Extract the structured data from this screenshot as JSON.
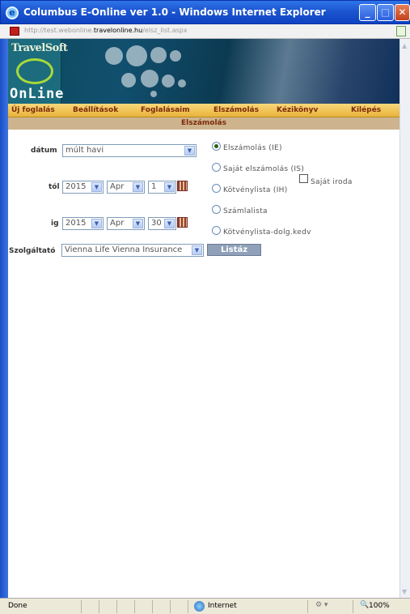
{
  "window": {
    "title": "Columbus E-Online ver 1.0 - Windows Internet Explorer",
    "url_prefix": "http://test.webonline.",
    "url_domain": "travelonline.hu",
    "url_path": "/elsz_list.aspx"
  },
  "logo": {
    "line1": "TravelSoft",
    "line2": "OnLine"
  },
  "menu": [
    "Új foglalás",
    "Beállítások",
    "Foglalásaim",
    "Elszámolás",
    "Kézikönyv",
    "Kilépés"
  ],
  "page": {
    "subtitle": "Elszámolás"
  },
  "form": {
    "datum_label": "dátum",
    "datum_value": "múlt havi",
    "tol_label": "tól",
    "tol_year": "2015",
    "tol_month": "Apr",
    "tol_day": "1",
    "ig_label": "ig",
    "ig_year": "2015",
    "ig_month": "Apr",
    "ig_day": "30",
    "szolgaltato_label": "Szolgáltató",
    "szolgaltato_value": "Vienna Life Vienna Insurance",
    "submit_label": "Listáz"
  },
  "options": [
    {
      "label": "Elszámolás (IE)",
      "selected": true
    },
    {
      "label": "Saját elszámolás (IS)",
      "selected": false
    },
    {
      "label": "Kötvénylista (IH)",
      "selected": false
    },
    {
      "label": "Számlalista",
      "selected": false
    },
    {
      "label": "Kötvénylista-dolg.kedv",
      "selected": false
    }
  ],
  "own_office_label": "Saját iroda",
  "status": {
    "text": "Done",
    "zone": "Internet",
    "zoom": "100%"
  }
}
